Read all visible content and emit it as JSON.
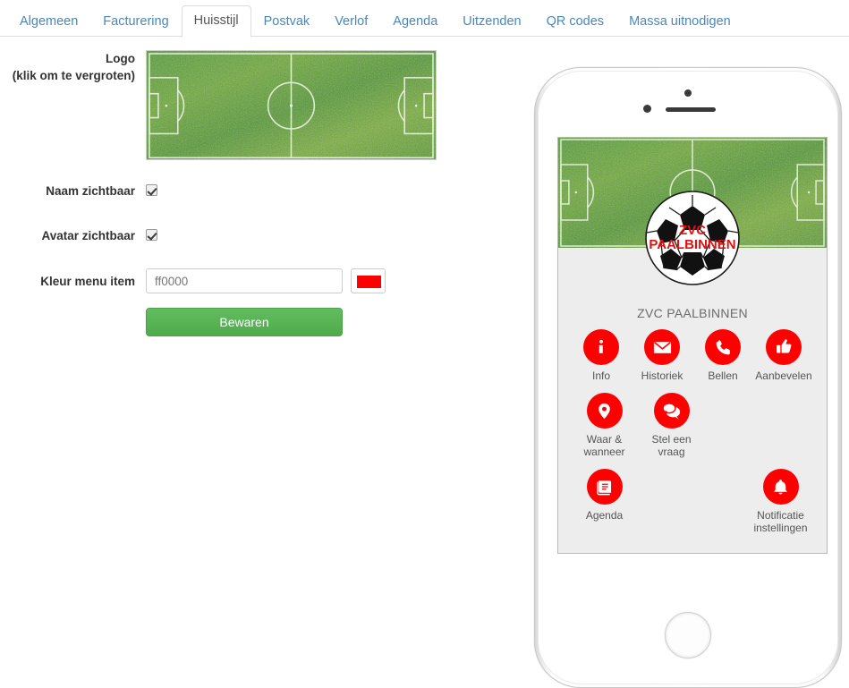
{
  "tabs": [
    {
      "label": "Algemeen",
      "active": false
    },
    {
      "label": "Facturering",
      "active": false
    },
    {
      "label": "Huisstijl",
      "active": true
    },
    {
      "label": "Postvak",
      "active": false
    },
    {
      "label": "Verlof",
      "active": false
    },
    {
      "label": "Agenda",
      "active": false
    },
    {
      "label": "Uitzenden",
      "active": false
    },
    {
      "label": "QR codes",
      "active": false
    },
    {
      "label": "Massa uitnodigen",
      "active": false
    }
  ],
  "form": {
    "logo_label_line1": "Logo",
    "logo_label_line2": "(klik om te vergroten)",
    "naam_zichtbaar_label": "Naam zichtbaar",
    "naam_zichtbaar_checked": true,
    "avatar_zichtbaar_label": "Avatar zichtbaar",
    "avatar_zichtbaar_checked": true,
    "kleur_label": "Kleur menu item",
    "kleur_value": "ff0000",
    "kleur_placeholder": "ff0000",
    "kleur_swatch_color": "#ff0000",
    "save_label": "Bewaren"
  },
  "preview": {
    "club_name": "ZVC PAALBINNEN",
    "avatar_text_line1": "ZVC",
    "avatar_text_line2": "PAALBINNEN",
    "accent_color": "#ff0000",
    "menu_rows": [
      [
        {
          "label": "Info",
          "icon": "info-icon"
        },
        {
          "label": "Historiek",
          "icon": "envelope-icon"
        },
        {
          "label": "Bellen",
          "icon": "phone-icon"
        },
        {
          "label": "Aanbevelen",
          "icon": "thumbs-up-icon"
        }
      ],
      [
        {
          "label": "Waar &\nwanneer",
          "icon": "location-pin-icon"
        },
        {
          "label": "Stel een\nvraag",
          "icon": "chat-bubbles-icon"
        }
      ],
      [
        {
          "label": "Agenda",
          "icon": "book-icon"
        },
        {
          "label": "Notificatie\ninstellingen",
          "icon": "bell-icon"
        }
      ]
    ]
  }
}
